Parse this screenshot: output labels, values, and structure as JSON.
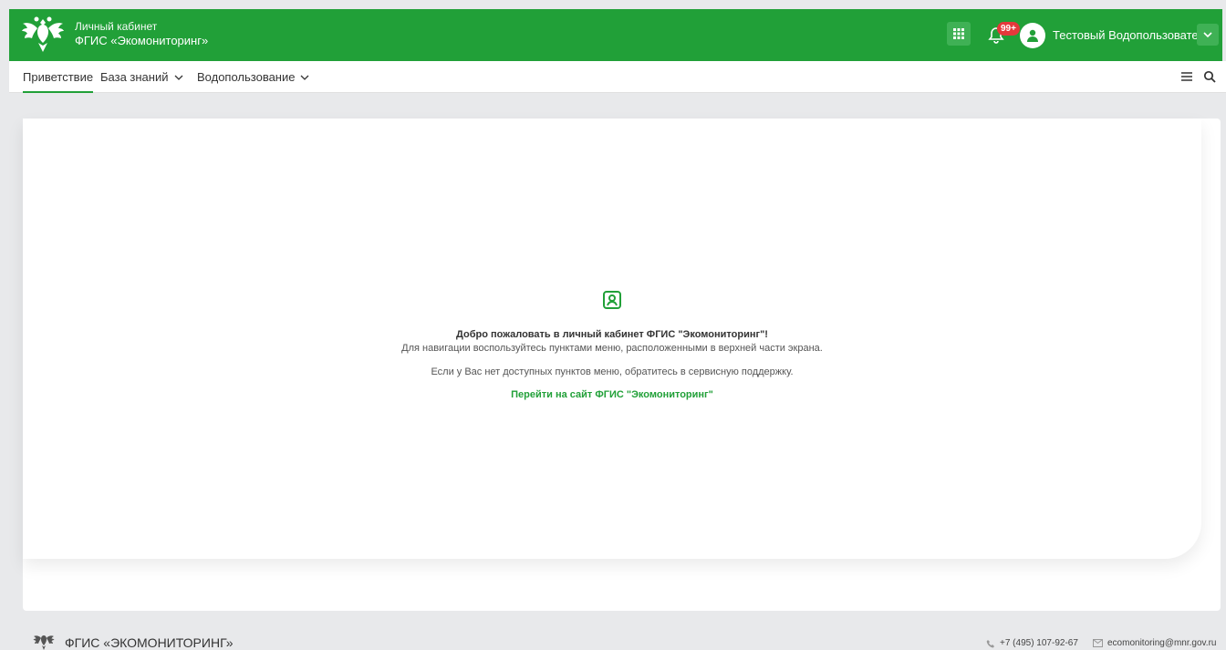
{
  "header": {
    "brand_line1": "Личный кабинет",
    "brand_line2": "ФГИС «Экомониторинг»",
    "notifications_badge": "99+",
    "user_name": "Тестовый Водопользователь"
  },
  "nav": {
    "items": [
      {
        "label": "Приветствие",
        "active": true
      },
      {
        "label": "База знаний",
        "dropdown": true
      },
      {
        "label": "Водопользование",
        "dropdown": true
      }
    ]
  },
  "welcome": {
    "title": "Добро пожаловать в личный кабинет ФГИС \"Экомониторинг\"!",
    "line1": "Для навигации воспользуйтесь пунктами меню, расположенными в верхней части экрана.",
    "line2": "Если у Вас нет доступных пунктов меню, обратитесь в сервисную поддержку.",
    "link": "Перейти на сайт ФГИС \"Экомониторинг\""
  },
  "footer": {
    "name": "ФГИС «ЭКОМОНИТОРИНГ»",
    "phone": "+7 (495) 107-92-67",
    "email": "ecomonitoring@mnr.gov.ru"
  },
  "colors": {
    "brand_green": "#21a038",
    "badge_red": "#e5383b",
    "background": "#e8e9eb"
  }
}
